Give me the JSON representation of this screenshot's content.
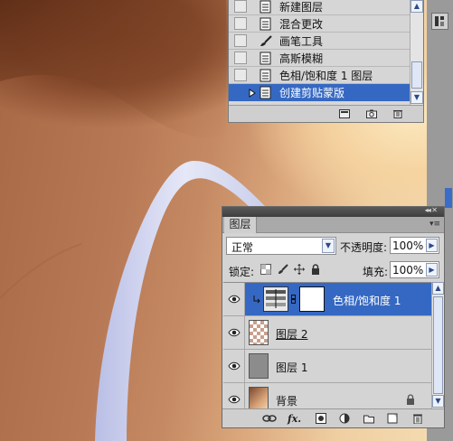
{
  "history_panel": {
    "items": [
      {
        "label": "新建图层",
        "icon": "document-state-icon"
      },
      {
        "label": "混合更改",
        "icon": "document-state-icon"
      },
      {
        "label": "画笔工具",
        "icon": "brush-icon"
      },
      {
        "label": "高斯模糊",
        "icon": "document-state-icon"
      },
      {
        "label": "色相/饱和度 1 图层",
        "icon": "document-state-icon"
      },
      {
        "label": "创建剪贴蒙版",
        "icon": "document-state-icon",
        "selected": true
      }
    ],
    "footer_icons": [
      "new-document-from-state-icon",
      "snapshot-camera-icon",
      "delete-trash-icon"
    ]
  },
  "layers_panel": {
    "tab_label": "图层",
    "blend_mode": "正常",
    "opacity_label": "不透明度:",
    "opacity_value": "100%",
    "lock_label": "锁定:",
    "lock_icons": [
      "lock-transparent-icon",
      "lock-brush-icon",
      "lock-move-icon",
      "lock-all-icon"
    ],
    "fill_label": "填充:",
    "fill_value": "100%",
    "layers": [
      {
        "name": "色相/饱和度 1",
        "type": "adjustment",
        "selected": true,
        "clipped": true
      },
      {
        "name": "图层 2",
        "type": "pixel",
        "underlined": true
      },
      {
        "name": "图层 1",
        "type": "pixel"
      },
      {
        "name": "背景",
        "type": "background",
        "locked": true
      }
    ],
    "footer_icons": [
      "link-layers-icon",
      "fx-icon",
      "add-mask-icon",
      "adjustment-layer-icon",
      "new-group-icon",
      "new-layer-icon",
      "delete-layer-icon"
    ]
  },
  "colors": {
    "selection": "#3568c2",
    "panel_bg": "#d4d4d4",
    "titlebar": "#4a4a4a"
  }
}
